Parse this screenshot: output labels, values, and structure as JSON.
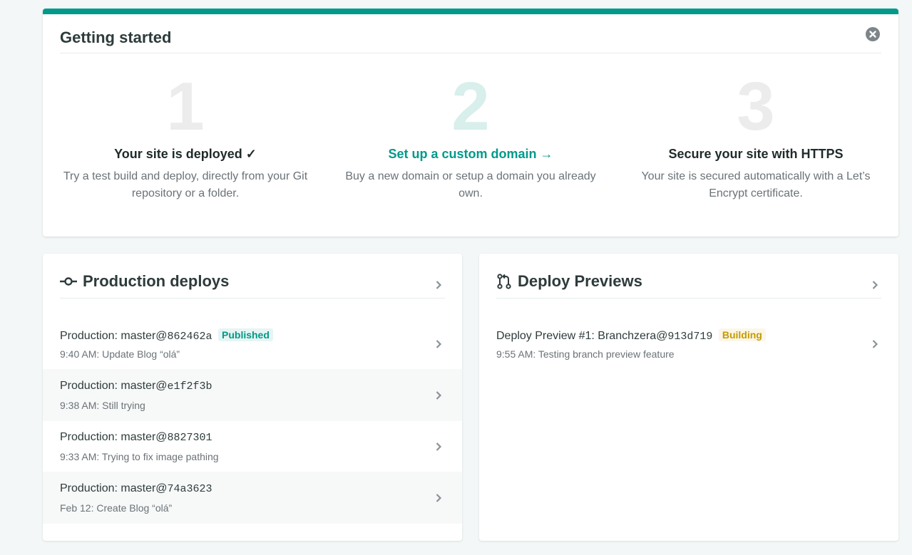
{
  "getting_started": {
    "title": "Getting started",
    "close_icon": "close-circle-icon",
    "steps": [
      {
        "number": "1",
        "heading": "Your site is deployed ✓",
        "description": "Try a test build and deploy, directly from your Git repository or a folder."
      },
      {
        "number": "2",
        "heading": "Set up a custom domain →",
        "description": "Buy a new domain or setup a domain you already own."
      },
      {
        "number": "3",
        "heading": "Secure your site with HTTPS",
        "description": "Your site is secured automatically with a Let’s Encrypt certificate."
      }
    ]
  },
  "production_deploys": {
    "title": "Production deploys",
    "icon": "commit-icon",
    "rows": [
      {
        "prefix": "Production: ",
        "branch": "master@",
        "sha": "862462a",
        "badge": "Published",
        "detail": "9:40 AM: Update Blog “olá”"
      },
      {
        "prefix": "Production: ",
        "branch": "master@",
        "sha": "e1f2f3b",
        "badge": "",
        "detail": "9:38 AM: Still trying"
      },
      {
        "prefix": "Production: ",
        "branch": "master@",
        "sha": "8827301",
        "badge": "",
        "detail": "9:33 AM: Trying to fix image pathing"
      },
      {
        "prefix": "Production: ",
        "branch": "master@",
        "sha": "74a3623",
        "badge": "",
        "detail": "Feb 12: Create Blog “olá”"
      }
    ]
  },
  "deploy_previews": {
    "title": "Deploy Previews",
    "icon": "pull-request-icon",
    "rows": [
      {
        "prefix": "Deploy Preview #1: ",
        "branch": "Branchzera@",
        "sha": "913d719",
        "badge": "Building",
        "detail": "9:55 AM: Testing branch preview feature"
      }
    ]
  },
  "colors": {
    "accent": "#00998a",
    "published_badge_bg": "#e6f5f3",
    "building_badge_text": "#c49a00",
    "building_badge_bg": "#fbf6e6"
  }
}
